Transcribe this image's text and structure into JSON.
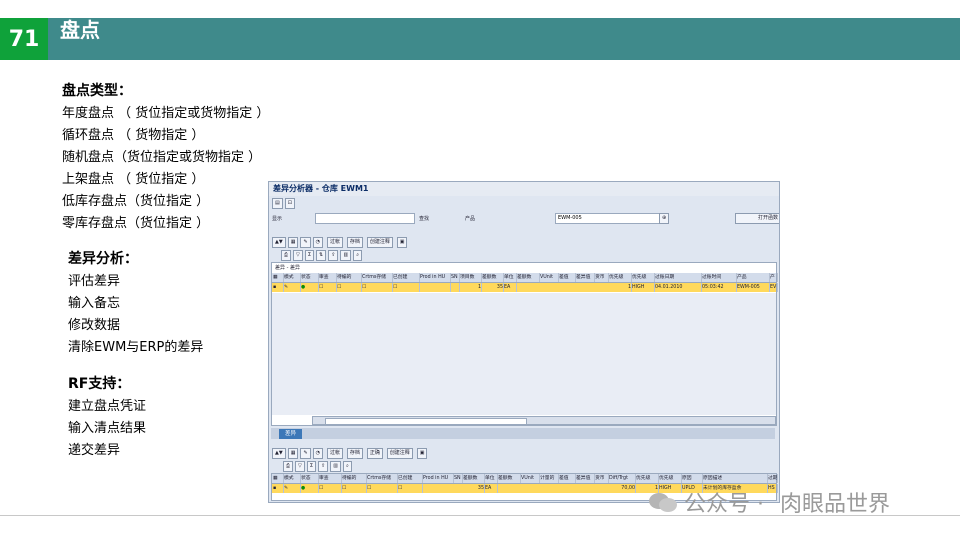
{
  "slide": {
    "number": "71",
    "title": "盘点"
  },
  "left": {
    "types_heading": "盘点类型：",
    "types": [
      "年度盘点 （ 货位指定或货物指定 ）",
      "循环盘点 （ 货物指定 ）",
      "随机盘点（货位指定或货物指定 ）",
      "上架盘点 （ 货位指定 ）",
      "低库存盘点（货位指定 ）",
      "零库存盘点（货位指定 ）"
    ],
    "diff_heading": "差异分析：",
    "diff_items": [
      "评估差异",
      "输入备忘",
      "修改数据",
      "清除EWM与ERP的差异"
    ],
    "rf_heading": "RF支持：",
    "rf_items": [
      "建立盘点凭证",
      "输入清点结果",
      "递交差异"
    ]
  },
  "sap": {
    "title": "差异分析器 - 仓库 EWM1",
    "show_label": "显示",
    "search_label": "查找",
    "product_label": "产品",
    "product_value": "EWM-005",
    "open_button": "打开函数",
    "toolbar1": [
      "过帐",
      "存档",
      "创建注释"
    ],
    "grid1_caption": "差异 - 差异",
    "grid1_headers": [
      "模式",
      "状态",
      "审查",
      "待编的",
      "Crtms存储",
      "已创建",
      "Prod in HU",
      "SN",
      "项目数",
      "差额数",
      "单位",
      "差额数",
      "VUnit",
      "差值",
      "差异值",
      "货币",
      "优先级",
      "优先级",
      "过账日期",
      "过账时间",
      "产品",
      "产"
    ],
    "grid1_row": [
      "",
      "",
      "",
      "",
      "",
      "",
      "",
      "",
      "1",
      "35",
      "EA",
      "",
      "",
      "",
      "",
      "",
      "1",
      "HIGH",
      "04.01.2010",
      "05:03:42",
      "EWM-005",
      "EV"
    ],
    "tab_label": "差异",
    "toolbar2": [
      "过帐",
      "存档",
      "正确",
      "创建注释"
    ],
    "grid2_headers": [
      "模式",
      "状态",
      "审查",
      "待编的",
      "Crtms存储",
      "已创建",
      "Prod in HU",
      "SN",
      "差额数",
      "单位",
      "差额数",
      "VUnit",
      "计量的",
      "差值",
      "差异值",
      "货币",
      "Diff/Trgt",
      "优先级",
      "优先级",
      "原因",
      "原因描述",
      "过期"
    ],
    "grid2_row": [
      "",
      "",
      "",
      "",
      "",
      "",
      "",
      "",
      "35",
      "EA",
      "",
      "",
      "",
      "",
      "",
      "",
      "70,00",
      "1",
      "HIGH",
      "UPLD",
      "未计划的库存盈余",
      "HS"
    ]
  },
  "watermark": {
    "left": "公众号 ·",
    "right": "肉眼品世界"
  }
}
